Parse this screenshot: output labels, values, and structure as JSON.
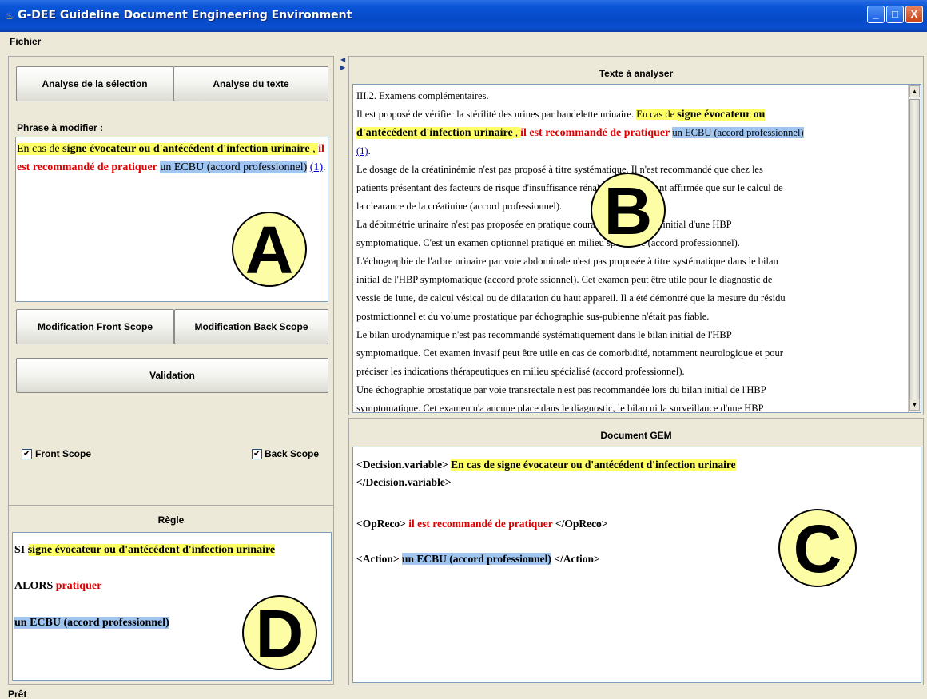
{
  "window": {
    "title": "G-DEE Guideline Document Engineering Environment",
    "minimize_glyph": "_",
    "maximize_glyph": "□",
    "close_glyph": "X"
  },
  "menu": {
    "file": "Fichier"
  },
  "left_panel": {
    "analyze_selection_label": "Analyse de la sélection",
    "analyze_text_label": "Analyse du texte",
    "phrase_label": "Phrase à modifier :",
    "phrase": {
      "p1": "En cas de ",
      "p2": "signe évocateur ou d'antécédent d'infection urinaire",
      "p3": " , ",
      "p4": "il est recommandé de pratiquer",
      "p5": " ",
      "p6": "un ECBU (accord professionnel)",
      "p7": " ",
      "p8": "(1)",
      "p9": "."
    },
    "annotation_letter": "A",
    "front_scope_btn": "Modification Front Scope",
    "back_scope_btn": "Modification Back Scope",
    "validation_btn": "Validation",
    "front_scope_check": "Front Scope",
    "back_scope_check": "Back Scope",
    "check_glyph": "✔"
  },
  "rule_panel": {
    "title": "Règle",
    "si_keyword": "SI",
    "si_condition": "signe évocateur ou d'antécédent d'infection urinaire",
    "alors_keyword": "ALORS",
    "alors_action": "pratiquer",
    "action_text": "un ECBU (accord professionnel)",
    "annotation_letter": "D"
  },
  "text_panel": {
    "title": "Texte à analyser",
    "annotation_letter": "B",
    "line1": "III.2. Examens complémentaires.",
    "line2a": "Il est proposé de vérifier la stérilité des urines par bandelette urinaire. ",
    "line2b": "En cas de ",
    "line2c": "signe évocateur ou",
    "line3a": "d'antécédent d'infection urinaire",
    "line3b": " , ",
    "line3c": "il est recommandé de pratiquer",
    "line3d": " ",
    "line3e": "un ECBU (accord professionnel)",
    "line4a": "(1)",
    "line4b": ".",
    "line5": "Le dosage de la créatininémie n'est pas proposé à titre systématique. Il n'est recommandé que chez les",
    "line6": "patients présentant des facteurs de risque d'insuffisance rénale, celle-ci n'étant affirmée que sur le calcul de",
    "line7": "la clearance de la créatinine (accord professionnel).",
    "line8": "La débitmétrie urinaire n'est pas proposée en pratique courante dans le bilan initial d'une HBP",
    "line9": "symptomatique. C'est un examen optionnel pratiqué en milieu spécialisé (accord professionnel).",
    "line10": "L'échographie de l'arbre urinaire par voie abdominale n'est pas proposée à titre systématique dans le bilan",
    "line11": "initial de l'HBP symptomatique (accord profe ssionnel). Cet examen peut être utile pour le diagnostic de",
    "line12": "vessie de lutte, de calcul vésical ou de dilatation du haut appareil. Il a été démontré que la mesure du résidu",
    "line13": "postmictionnel et du volume prostatique par échographie sus-pubienne n'était pas fiable.",
    "line14": "Le bilan urodynamique n'est pas recommandé systématiquement dans le bilan initial de l'HBP",
    "line15": "symptomatique. Cet examen invasif peut être utile en cas de comorbidité, notamment neurologique et pour",
    "line16": "préciser les indications thérapeutiques en milieu spécialisé (accord professionnel).",
    "line17": "Une échographie prostatique par voie transrectale n'est pas recommandée lors du bilan initial de l'HBP",
    "line18": "symptomatique. Cet examen n'a aucune place dans le diagnostic, le bilan ni la surveillance d'une HBP"
  },
  "gem_panel": {
    "title": "Document GEM",
    "dv_open": "<Decision.variable>",
    "dv_text": "En cas de signe évocateur ou d'antécédent d'infection urinaire",
    "dv_close": "</Decision.variable>",
    "op_open": "<OpReco>",
    "op_text": "il est recommandé de pratiquer",
    "op_close": "</OpReco>",
    "act_open": "<Action>",
    "act_text": "un ECBU (accord professionnel)",
    "act_close": "</Action>",
    "annotation_letter": "C"
  },
  "status": {
    "text": "Prêt"
  },
  "colors": {
    "highlight_yellow": "#ffff66",
    "highlight_blue": "#9fc5f0",
    "recommendation_red": "#e00000",
    "titlebar_blue": "#0649c6"
  }
}
